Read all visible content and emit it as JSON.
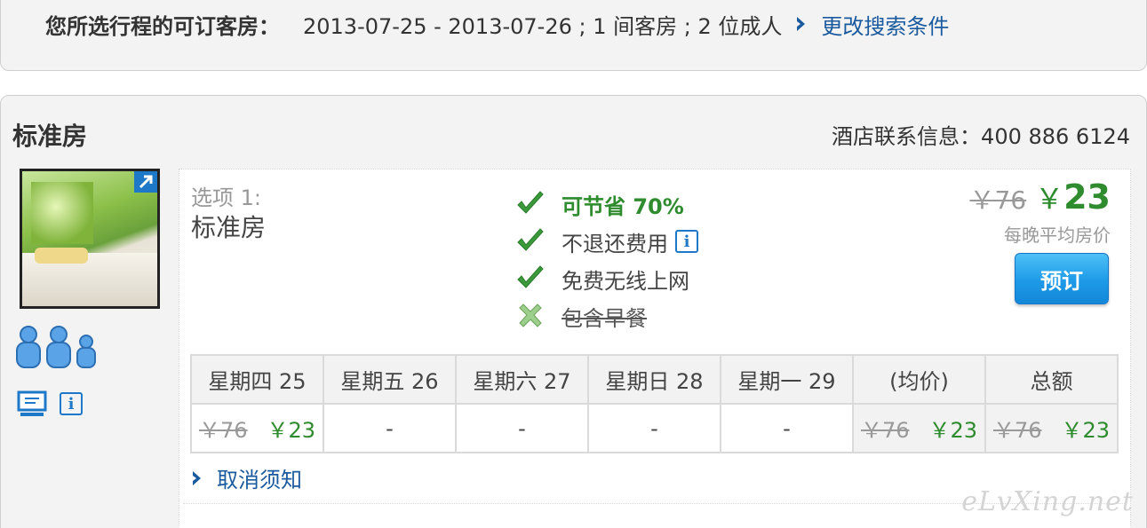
{
  "summary": {
    "label": "您所选行程的可订客房：",
    "value": "2013-07-25 - 2013-07-26 ; 1 间客房 ; 2 位成人",
    "change_link": "更改搜索条件"
  },
  "room": {
    "title": "标准房",
    "contact": "酒店联系信息：400 886 6124"
  },
  "option": {
    "number": "选项 1:",
    "name": "标准房",
    "benefits": [
      {
        "text": "可节省 70%",
        "icon": "check-icon"
      },
      {
        "text": "不退还费用",
        "icon": "check-icon"
      },
      {
        "text": "免费无线上网",
        "icon": "check-icon"
      },
      {
        "text": "包含早餐",
        "icon": "cross-icon"
      }
    ],
    "price_old": "￥76",
    "price_currency": "￥",
    "price_new": "23",
    "price_note": "每晚平均房价",
    "book_label": "预订",
    "cancel_link": "取消须知"
  },
  "rate_table": {
    "headers": [
      "星期四  25",
      "星期五  26",
      "星期六  27",
      "星期日  28",
      "星期一  29",
      "(均价)",
      "总额"
    ],
    "row": [
      {
        "old": "￥76",
        "new": "￥23"
      },
      {
        "text": "-"
      },
      {
        "text": "-"
      },
      {
        "text": "-"
      },
      {
        "text": "-"
      },
      {
        "old": "￥76",
        "new": "￥23"
      },
      {
        "old": "￥76",
        "new": "￥23"
      }
    ]
  },
  "watermark": "eLvXing.net",
  "colors": {
    "link": "#1a5a9e",
    "accent_green": "#2e8b2e",
    "button_blue": "#1d9ae8",
    "panel_bg": "#f3f3f3"
  }
}
